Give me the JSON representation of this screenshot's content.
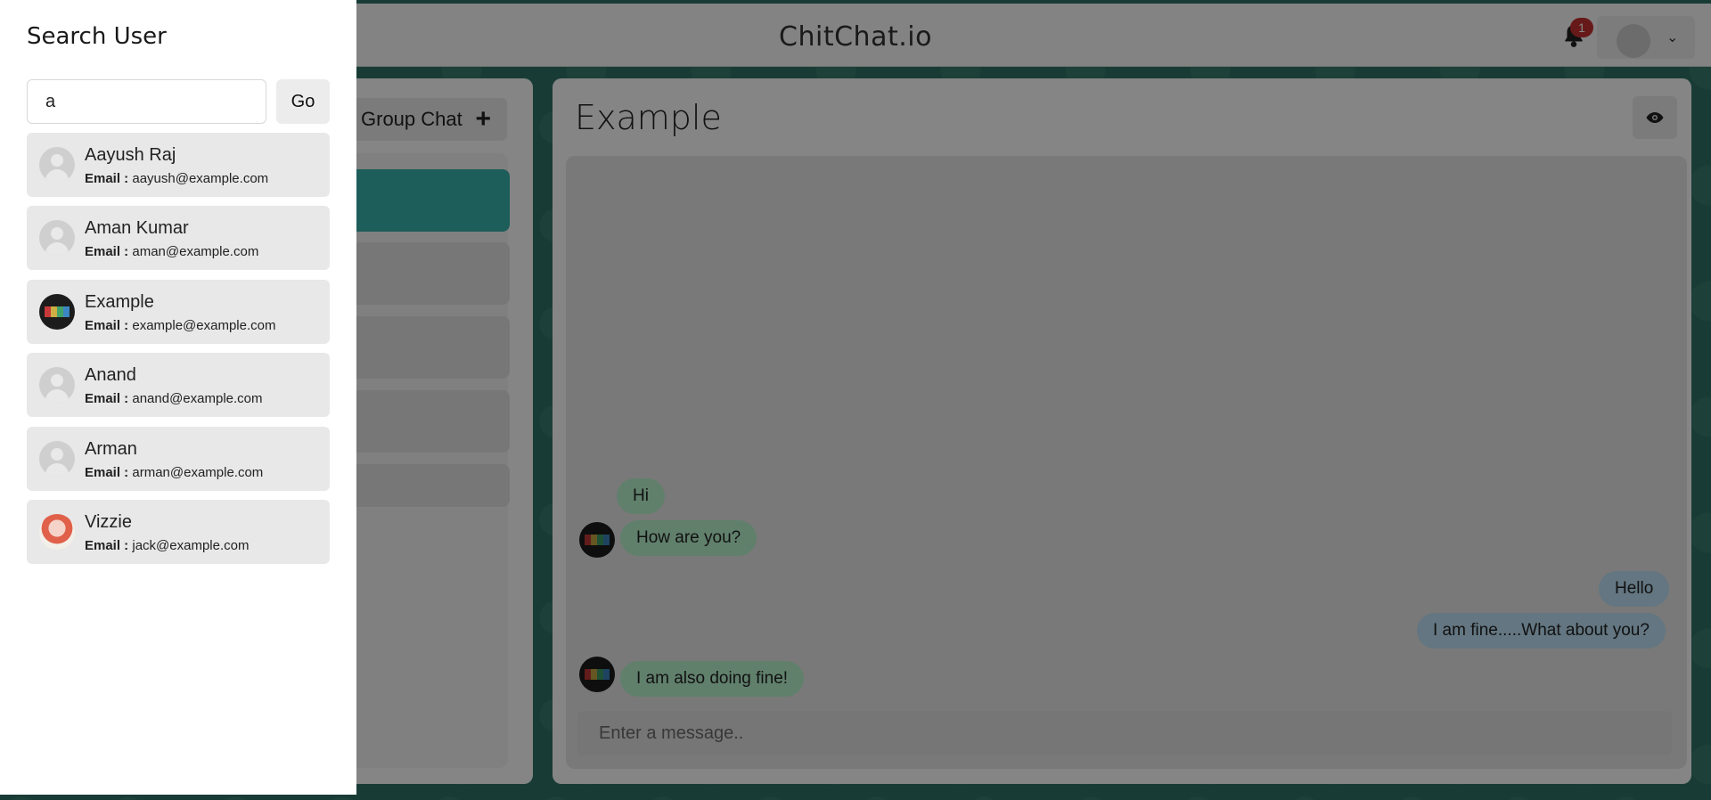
{
  "app": {
    "title": "ChitChat.io"
  },
  "notifications": {
    "count": "1"
  },
  "sidebar": {
    "group_chat_label": "Group Chat"
  },
  "chat": {
    "title": "Example",
    "messages": [
      {
        "text": "Hi",
        "direction": "in"
      },
      {
        "text": "How are you?",
        "direction": "in"
      },
      {
        "text": "Hello",
        "direction": "out"
      },
      {
        "text": "I am fine.....What about you?",
        "direction": "out"
      },
      {
        "text": "I am also doing fine!",
        "direction": "in"
      }
    ],
    "input_placeholder": "Enter a message.."
  },
  "drawer": {
    "title": "Search User",
    "search_value": "a",
    "go_label": "Go",
    "email_label": "Email :",
    "results": [
      {
        "name": "Aayush Raj",
        "email": "aayush@example.com",
        "avatar": "default"
      },
      {
        "name": "Aman Kumar",
        "email": "aman@example.com",
        "avatar": "default"
      },
      {
        "name": "Example",
        "email": "example@example.com",
        "avatar": "brand"
      },
      {
        "name": "Anand",
        "email": "anand@example.com",
        "avatar": "default"
      },
      {
        "name": "Arman",
        "email": "arman@example.com",
        "avatar": "default"
      },
      {
        "name": "Vizzie",
        "email": "jack@example.com",
        "avatar": "vizzie"
      }
    ]
  },
  "colors": {
    "accent": "#38b2ac",
    "incoming": "#b9f5d0",
    "outgoing": "#bee3f8",
    "badge": "#c53030"
  }
}
